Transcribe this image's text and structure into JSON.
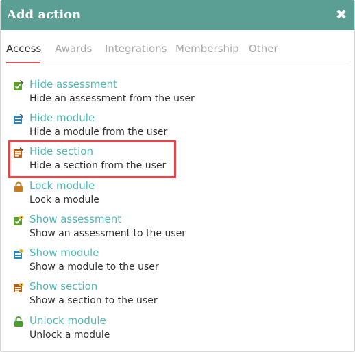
{
  "dialog": {
    "title": "Add action",
    "close_icon": "close-icon"
  },
  "tabs": [
    {
      "label": "Access",
      "active": true
    },
    {
      "label": "Awards",
      "active": false
    },
    {
      "label": "Integrations",
      "active": false
    },
    {
      "label": "Membership",
      "active": false
    },
    {
      "label": "Other",
      "active": false
    }
  ],
  "actions": [
    {
      "name": "Hide assessment",
      "description": "Hide an assessment from the user",
      "icon": "hide-assessment-icon",
      "color": "#5b9e2b"
    },
    {
      "name": "Hide module",
      "description": "Hide a module from the user",
      "icon": "hide-module-icon",
      "color": "#2f86b3"
    },
    {
      "name": "Hide section",
      "description": "Hide a section from the user",
      "icon": "hide-section-icon",
      "color": "#b85f12"
    },
    {
      "name": "Lock module",
      "description": "Lock a module",
      "icon": "lock-icon",
      "color": "#c97a1e"
    },
    {
      "name": "Show assessment",
      "description": "Show an assessment to the user",
      "icon": "show-assessment-icon",
      "color": "#5b9e2b"
    },
    {
      "name": "Show module",
      "description": "Show a module to the user",
      "icon": "show-module-icon",
      "color": "#2f86b3"
    },
    {
      "name": "Show section",
      "description": "Show a section to the user",
      "icon": "show-section-icon",
      "color": "#b85f12"
    },
    {
      "name": "Unlock module",
      "description": "Unlock a module",
      "icon": "unlock-icon",
      "color": "#4a9e2e"
    }
  ],
  "colors": {
    "header": "#5a9e94",
    "accent": "#d9534f",
    "link": "#4fb9b6",
    "highlight": "#e8444a"
  }
}
